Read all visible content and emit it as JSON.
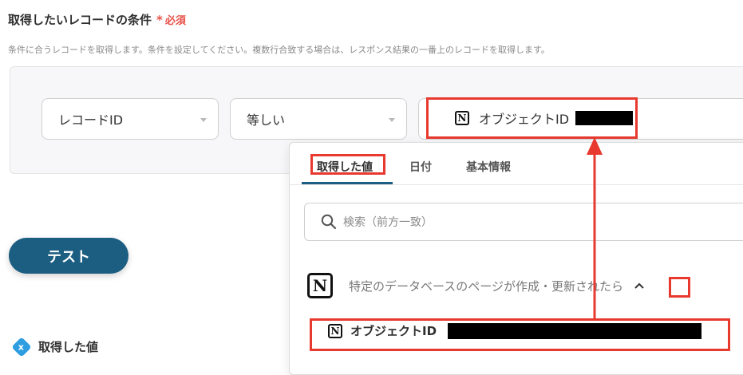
{
  "section": {
    "title": "取得したいレコードの条件",
    "required_mark": "*",
    "required_label": "必須",
    "description": "条件に合うレコードを取得します。条件を設定してください。複数行合致する場合は、レスポンス結果の一番上のレコードを取得します。"
  },
  "condition": {
    "field": "レコードID",
    "operator": "等しい",
    "value_label": "オブジェクトID"
  },
  "test_button": "テスト",
  "result": {
    "title": "取得した値",
    "badge_icon": "x"
  },
  "panel": {
    "tabs": [
      {
        "label": "取得した値",
        "active": true
      },
      {
        "label": "日付",
        "active": false
      },
      {
        "label": "基本情報",
        "active": false
      }
    ],
    "search_placeholder": "検索（前方一致）",
    "trigger_title": "特定のデータベースのページが作成・更新されたら",
    "option_label": "オブジェクトID"
  },
  "icons": {
    "notion": "N",
    "search": "search-icon",
    "collapse": "chevron-up-icon"
  },
  "colors": {
    "accent": "#1c5e82",
    "highlight": "#e8392f",
    "required": "#e8524a"
  }
}
